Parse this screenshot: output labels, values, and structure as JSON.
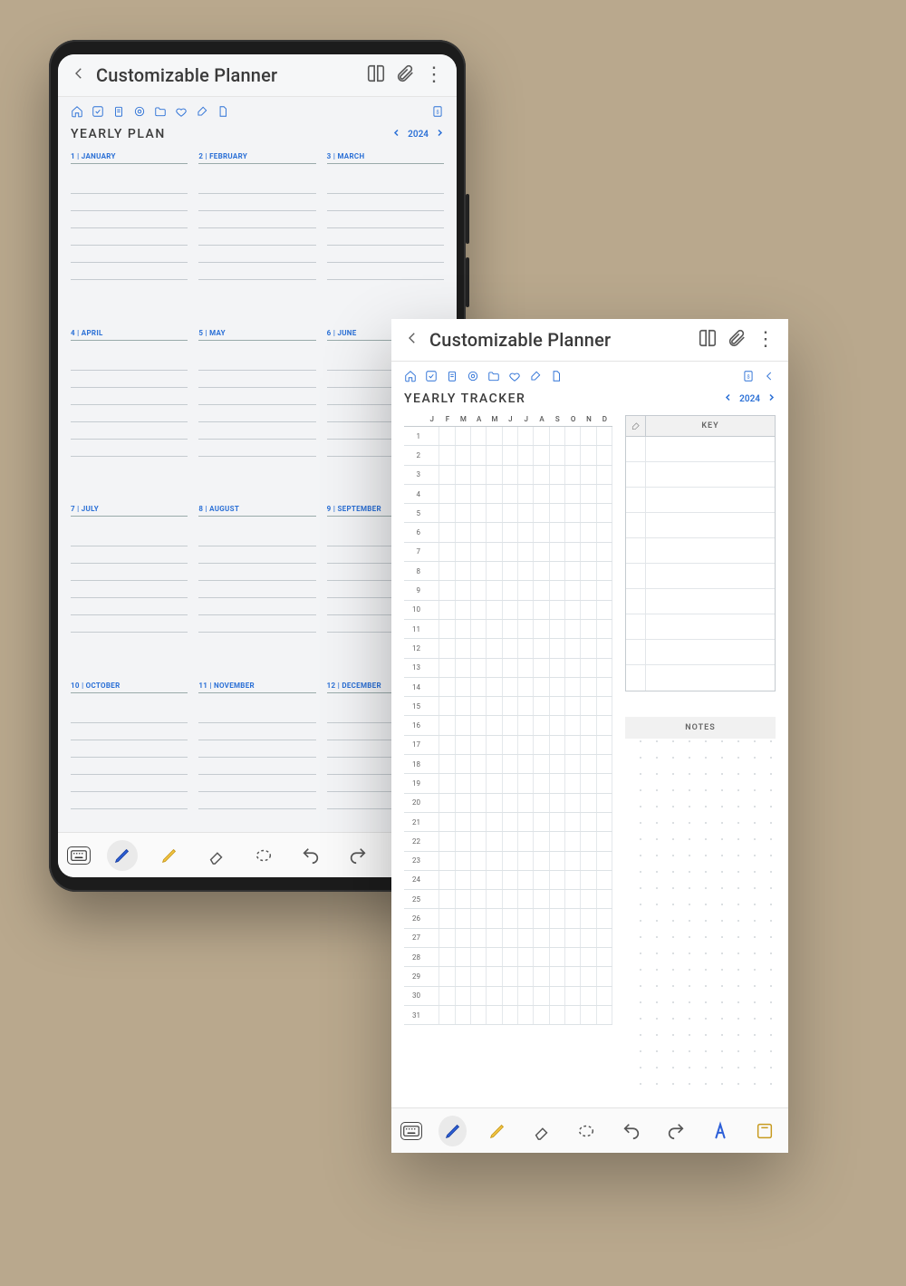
{
  "app_title": "Customizable Planner",
  "year": "2024",
  "plan": {
    "heading": "YEARLY PLAN",
    "months": [
      {
        "n": "1",
        "name": "JANUARY"
      },
      {
        "n": "2",
        "name": "FEBRUARY"
      },
      {
        "n": "3",
        "name": "MARCH"
      },
      {
        "n": "4",
        "name": "APRIL"
      },
      {
        "n": "5",
        "name": "MAY"
      },
      {
        "n": "6",
        "name": "JUNE"
      },
      {
        "n": "7",
        "name": "JULY"
      },
      {
        "n": "8",
        "name": "AUGUST"
      },
      {
        "n": "9",
        "name": "SEPTEMBER"
      },
      {
        "n": "10",
        "name": "OCTOBER"
      },
      {
        "n": "11",
        "name": "NOVEMBER"
      },
      {
        "n": "12",
        "name": "DECEMBER"
      }
    ]
  },
  "tracker": {
    "heading": "YEARLY TRACKER",
    "month_initials": [
      "J",
      "F",
      "M",
      "A",
      "M",
      "J",
      "J",
      "A",
      "S",
      "O",
      "N",
      "D"
    ],
    "days": [
      "1",
      "2",
      "3",
      "4",
      "5",
      "6",
      "7",
      "8",
      "9",
      "10",
      "11",
      "12",
      "13",
      "14",
      "15",
      "16",
      "17",
      "18",
      "19",
      "20",
      "21",
      "22",
      "23",
      "24",
      "25",
      "26",
      "27",
      "28",
      "29",
      "30",
      "31"
    ],
    "key_label": "KEY",
    "notes_label": "NOTES"
  }
}
